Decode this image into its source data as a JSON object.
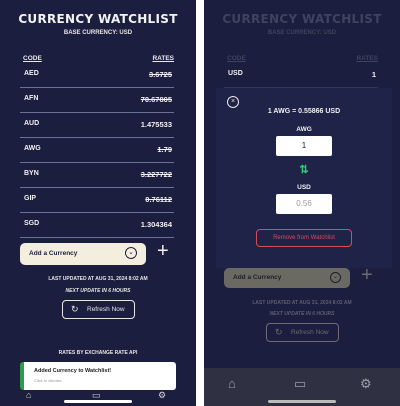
{
  "app": {
    "title": "CURRENCY WATCHLIST",
    "base_currency": "BASE CURRENCY: USD"
  },
  "table": {
    "code_header": "CODE",
    "rates_header": "RATES",
    "rows": [
      {
        "code": "AED",
        "rate": "3.6725"
      },
      {
        "code": "AFN",
        "rate": "70.67805"
      },
      {
        "code": "AUD",
        "rate": "1.475533"
      },
      {
        "code": "AWG",
        "rate": "1.79"
      },
      {
        "code": "BYN",
        "rate": "3.227722"
      },
      {
        "code": "GIP",
        "rate": "0.76112"
      },
      {
        "code": "SGD",
        "rate": "1.304364"
      }
    ]
  },
  "controls": {
    "add_currency_label": "Add a Currency",
    "plus_glyph": "+",
    "chevron_glyph": "⌄",
    "refresh_label": "Refresh Now",
    "refresh_glyph": "↻"
  },
  "status": {
    "last_updated": "LAST UPDATED AT AUG 31, 2024 8:02 AM",
    "next_update": "NEXT UPDATE IN 6 HOURS",
    "powered_by": "RATES BY EXCHANGE RATE API"
  },
  "toast": {
    "message": "Added Currency to Watchlist!",
    "hint": "Click to dismiss"
  },
  "right_screen": {
    "title": "CURRENCY WATCHLIST",
    "base_currency": "BASE CURRENCY: USD",
    "code_header": "CODE",
    "rates_header": "RATES",
    "first_row": {
      "code": "USD",
      "rate": "1"
    },
    "add_currency_label": "Add a Currency",
    "last_updated": "LAST UPDATED AT AUG 31, 2024 8:02 AM",
    "next_update": "NEXT UPDATE IN 6 HOURS",
    "refresh_label": "Refresh Now"
  },
  "modal": {
    "close_glyph": "×",
    "conversion": "1 AWG = 0.55866 USD",
    "from_label": "AWG",
    "from_value": "1",
    "swap_glyph": "⇅",
    "to_label": "USD",
    "to_value": "0.56",
    "remove_label": "Remove from Watchlist"
  },
  "icons": {
    "home": "⌂",
    "wallet": "▭",
    "settings": "⚙"
  },
  "colors": {
    "background": "#1b1e3e",
    "modal": "#1f2347",
    "accent_cream": "#f4eede",
    "success": "#2e9a4d",
    "swap": "#2ecc71",
    "danger": "#d64c5b"
  }
}
